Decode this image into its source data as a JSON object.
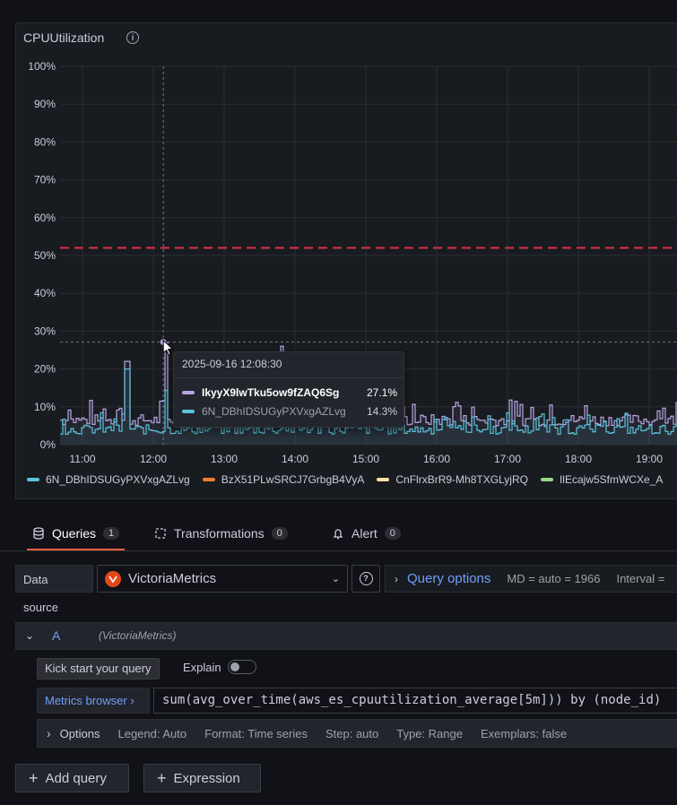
{
  "panel": {
    "title": "CPUUtilization",
    "info_icon": "info-circle-icon"
  },
  "chart_data": {
    "type": "line",
    "ylim": [
      0,
      100
    ],
    "y_ticks": [
      "100%",
      "90%",
      "80%",
      "70%",
      "60%",
      "50%",
      "40%",
      "30%",
      "20%",
      "10%",
      "0%"
    ],
    "x_ticks": [
      "11:00",
      "12:00",
      "13:00",
      "14:00",
      "15:00",
      "16:00",
      "17:00",
      "18:00",
      "19:00"
    ],
    "threshold": {
      "value": 52,
      "color": "#e02f44",
      "style": "dashed"
    },
    "crosshair_x": "12:08:30",
    "crosshair_y": 27.1,
    "grid": true,
    "series": [
      {
        "name": "6N_DBhIDSUGyPXVxgAZLvg",
        "color": "#5ac4dd"
      },
      {
        "name": "BzX51PLwSRCJ7GrbgB4VyA",
        "color": "#f07e30"
      },
      {
        "name": "CnFlrxBrR9-Mh8TXGLyjRQ",
        "color": "#fce2a2"
      },
      {
        "name": "IlEcajw5SfmWCXe_A",
        "color": "#96d98d"
      },
      {
        "name": "IkyyX9lwTku5ow9fZAQ6Sg",
        "color": "#b7a6e6"
      }
    ]
  },
  "tooltip": {
    "time": "2025-09-16 12:08:30",
    "rows": [
      {
        "name": "IkyyX9lwTku5ow9fZAQ6Sg",
        "value": "27.1%",
        "color": "#b7a6e6"
      },
      {
        "name": "6N_DBhIDSUGyPXVxgAZLvg",
        "value": "14.3%",
        "color": "#5ac4dd"
      }
    ]
  },
  "legend": [
    {
      "name": "6N_DBhIDSUGyPXVxgAZLvg",
      "color": "#5ac4dd"
    },
    {
      "name": "BzX51PLwSRCJ7GrbgB4VyA",
      "color": "#f07e30"
    },
    {
      "name": "CnFlrxBrR9-Mh8TXGLyjRQ",
      "color": "#fce2a2"
    },
    {
      "name": "IlEcajw5SfmWCXe_A",
      "color": "#96d98d"
    }
  ],
  "tabs": [
    {
      "label": "Queries",
      "count": "1",
      "icon": "database-icon",
      "active": true
    },
    {
      "label": "Transformations",
      "count": "0",
      "icon": "transform-icon",
      "active": false
    },
    {
      "label": "Alert",
      "count": "0",
      "icon": "bell-icon",
      "active": false
    }
  ],
  "datasource": {
    "label": "Data source",
    "selected": "VictoriaMetrics",
    "help_icon": "question-circle-icon"
  },
  "query_options": {
    "title": "Query options",
    "md": "MD = auto = 1966",
    "interval": "Interval ="
  },
  "query": {
    "ref": "A",
    "ds": "(VictoriaMetrics)",
    "kick_start": "Kick start your query",
    "explain": "Explain",
    "metrics_browser": "Metrics browser",
    "expr": "sum(avg_over_time(aws_es_cpuutilization_average[5m])) by (node_id)",
    "options_label": "Options",
    "legend": "Legend: Auto",
    "format": "Format: Time series",
    "step": "Step: auto",
    "type": "Type: Range",
    "exemplars": "Exemplars: false"
  },
  "buttons": {
    "add_query": "Add query",
    "expression": "Expression"
  },
  "colors": {
    "accent_blue": "#6e9fff",
    "active_tab": "#f55f3e",
    "background": "#111217",
    "panel": "#181b1f"
  }
}
